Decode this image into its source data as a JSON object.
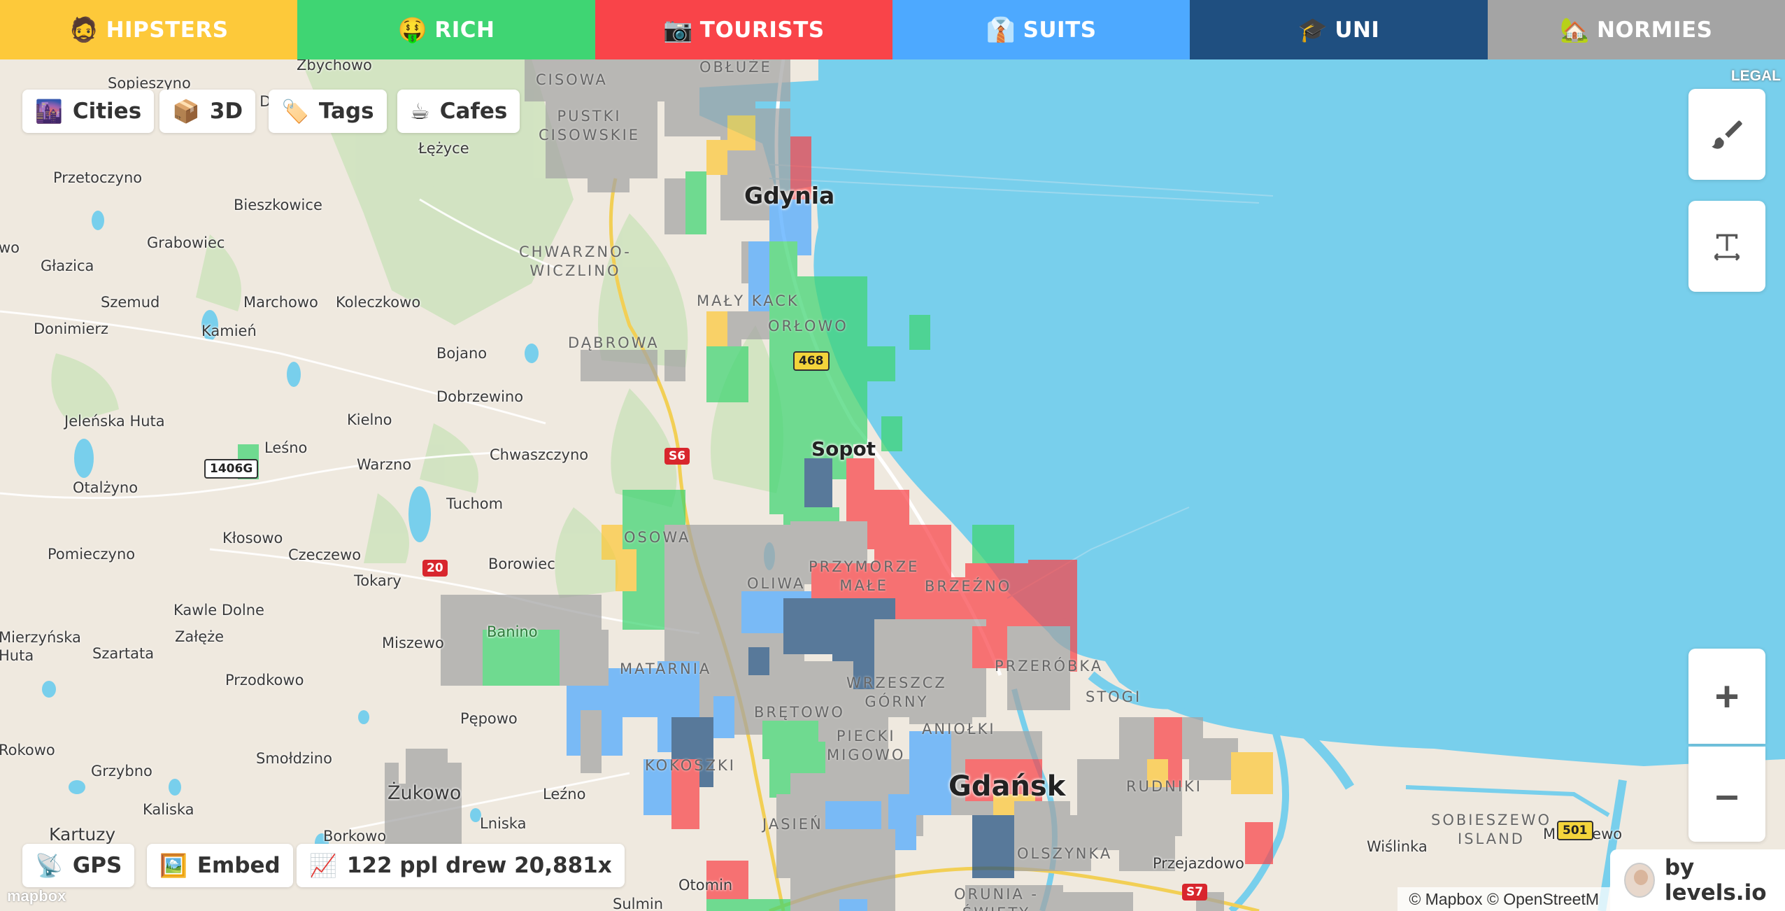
{
  "categories": [
    {
      "emoji": "🧔",
      "label": "HIPSTERS",
      "color": "#fdc93a"
    },
    {
      "emoji": "🤑",
      "label": "RICH",
      "color": "#3fd573"
    },
    {
      "emoji": "📷",
      "label": "TOURISTS",
      "color": "#f94449"
    },
    {
      "emoji": "👔",
      "label": "SUITS",
      "color": "#4da9ff"
    },
    {
      "emoji": "🎓",
      "label": "UNI",
      "color": "#1f4f80"
    },
    {
      "emoji": "🏡",
      "label": "NORMIES",
      "color": "#a4a4a4"
    }
  ],
  "top_chips": {
    "cities": {
      "emoji": "🌆",
      "label": "Cities"
    },
    "threed": {
      "emoji": "📦",
      "label": "3D"
    },
    "tags": {
      "emoji": "🏷️",
      "label": "Tags"
    },
    "cafes": {
      "emoji": "☕",
      "label": "Cafes"
    }
  },
  "bottom_chips": {
    "gps": {
      "emoji": "📡",
      "label": "GPS"
    },
    "embed": {
      "emoji": "🖼️",
      "label": "Embed"
    },
    "stats": {
      "emoji": "📈",
      "label": "122 ppl drew 20,881x"
    }
  },
  "legal": "LEGAL",
  "attribution": "© Mapbox © OpenStreetM",
  "mapbox_logo": "mapbox",
  "byline": "by levels.io",
  "zoom": {
    "in": "+",
    "out": "–"
  },
  "map": {
    "cities": {
      "gdynia": "Gdynia",
      "sopot": "Sopot",
      "gdansk": "Gdańsk"
    },
    "places": {
      "p1": "Zbychowo",
      "p2": "Sopieszyno",
      "p3": "Łężyce",
      "p4": "Przetoczyno",
      "p5": "Bieszkowice",
      "p6": "Grabowiec",
      "p7": "Głazica",
      "p8": "Szemud",
      "p9": "Marchowo",
      "p10": "Koleczkowo",
      "p11": "Donimierz",
      "p12": "Kamień",
      "p13": "Bojano",
      "p14": "Dobrzewino",
      "p15": "Jeleńska Huta",
      "p16": "Kielno",
      "p17": "Leśno",
      "p18": "Warzno",
      "p19": "Chwaszczyno",
      "p20": "Otalżyno",
      "p21": "Tuchom",
      "p22": "Kłosowo",
      "p23": "Pomieczyno",
      "p24": "Czeczewo",
      "p25": "Borowiec",
      "p26": "Tokary",
      "p27": "Kawle Dolne",
      "p28": "Załęże",
      "p29": "Szartata",
      "p30": "Miszewo",
      "p31": "Banino",
      "p32": "Przodkowo",
      "p33": "Pępowo",
      "p34": "Smołdzino",
      "p35": "Grzybno",
      "p36": "Żukowo",
      "p37": "Kaliska",
      "p38": "Leźno",
      "p39": "Borkowo",
      "p40": "Lniska",
      "p41": "Kartuzy",
      "p42": "Otomin",
      "p43": "Sulmin",
      "p44": "Przejazdowo",
      "p45": "Wiślinka",
      "p46": "Mikoszewo",
      "p47": "Rokowo",
      "p48": "Mierzyńska Huta",
      "p49": "wo",
      "p50": "y D"
    },
    "districts": {
      "d1": "CISOWA",
      "d2": "OBŁUŻE",
      "d3": "PUSTKI\nCISOWSKIE",
      "d4": "CHWARZNO-\nWICZLINO",
      "d5": "MAŁY KACK",
      "d6": "ORŁOWO",
      "d7": "DĄBROWA",
      "d8": "OSOWA",
      "d9": "PRZYMORZE\nMAŁE",
      "d10": "OLIWA",
      "d11": "BRZEŹNO",
      "d12": "MATARNIA",
      "d13": "WRZESZCZ\nGÓRNY",
      "d14": "PRZERÓBKA",
      "d15": "BRĘTOWO",
      "d16": "STOGI",
      "d17": "ANIOŁKI",
      "d18": "PIECKI\nMIGOWO",
      "d19": "KOKOSZKI",
      "d20": "RUDNIKI",
      "d21": "JASIEŃ",
      "d22": "OLSZYNKA",
      "d23": "ORUNIA -\nŚWIĘTY",
      "d24": "SOBIESZEWO\nISLAND"
    },
    "road_signs": {
      "r1": "468",
      "r2": "S6",
      "r3": "1406G",
      "r4": "20",
      "r5": "S7",
      "r6": "501"
    }
  }
}
